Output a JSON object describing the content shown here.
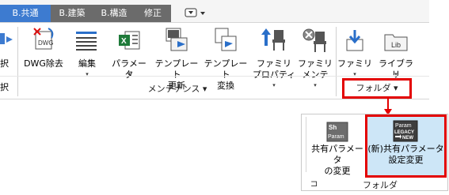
{
  "tabs": [
    {
      "label": "B.共通",
      "active": true
    },
    {
      "label": "B.建築",
      "active": false
    },
    {
      "label": "B.構造",
      "active": false
    },
    {
      "label": "修正",
      "active": false
    }
  ],
  "ribbon": {
    "partial_left_label_1": "択",
    "partial_left_label_2": "択",
    "buttons": [
      {
        "label": "DWG除去",
        "icon": "dwg-remove-icon"
      },
      {
        "label": "編集",
        "icon": "edit-list-icon",
        "dropdown": "▾"
      },
      {
        "label": "パラメータ",
        "icon": "parameter-excel-icon",
        "dropdown": "▾"
      },
      {
        "label": "テンプレート\n更新",
        "icon": "template-update-icon"
      },
      {
        "label": "テンプレート\n変換",
        "icon": "template-convert-icon"
      },
      {
        "label": "ファミリ\nプロパティ",
        "icon": "family-property-icon",
        "dropdown": "▾"
      },
      {
        "label": "ファミリ\nメンテ",
        "icon": "family-maintenance-icon",
        "dropdown": "▾"
      },
      {
        "label": "ファミリ",
        "icon": "family-download-icon",
        "dropdown": "▾"
      },
      {
        "label": "ライブラリ",
        "icon": "library-icon",
        "dropdown": "▾"
      }
    ],
    "panel_maintenance": "メンテナンス ▾",
    "panel_folder": "フォルダ ▾"
  },
  "popup": {
    "button1": {
      "label": "共有パラメータ\nの変更",
      "icon_text_top": "Sh",
      "icon_text_bottom": "Param"
    },
    "button2": {
      "label": "(新)共有パラメータ\n設定変更",
      "icon_text_top": "Param",
      "icon_text_mid": "LEGACY",
      "icon_text_bottom": "NEW"
    },
    "footer": "フォルダ",
    "pin": "⊐"
  },
  "colors": {
    "accent": "#3d7bd0",
    "highlight": "#e30000",
    "selected_bg": "#cde6f7"
  }
}
